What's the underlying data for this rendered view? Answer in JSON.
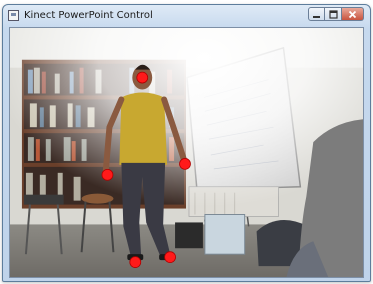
{
  "window": {
    "title": "Kinect PowerPoint Control",
    "controls": {
      "minimize_icon": "minimize-icon",
      "maximize_icon": "maximize-icon",
      "close_icon": "close-icon"
    }
  },
  "camera_view": {
    "joint_color": "#ff1a1a",
    "joints": [
      "head",
      "left-hand",
      "right-hand",
      "left-foot",
      "right-foot"
    ]
  }
}
